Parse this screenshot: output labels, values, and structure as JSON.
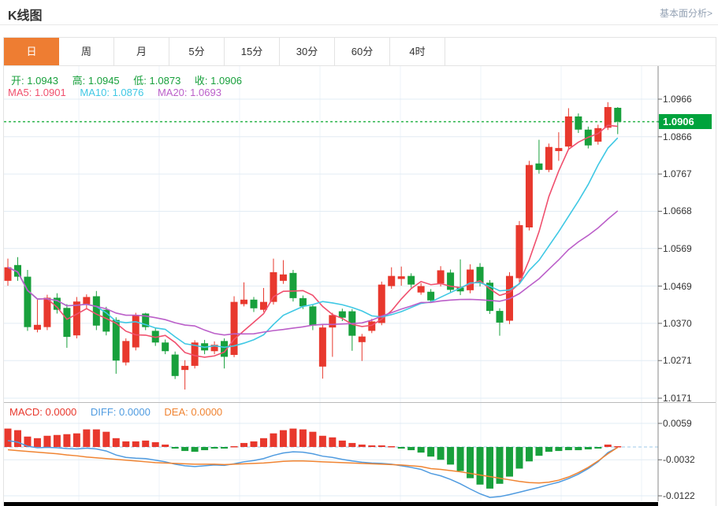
{
  "header": {
    "title": "K线图",
    "analysis_link": "基本面分析>"
  },
  "tabs": [
    {
      "label": "日",
      "active": true
    },
    {
      "label": "周",
      "active": false
    },
    {
      "label": "月",
      "active": false
    },
    {
      "label": "5分",
      "active": false
    },
    {
      "label": "15分",
      "active": false
    },
    {
      "label": "30分",
      "active": false
    },
    {
      "label": "60分",
      "active": false
    },
    {
      "label": "4时",
      "active": false
    }
  ],
  "legend": {
    "ohlc": [
      {
        "label": "开:",
        "value": "1.0943"
      },
      {
        "label": "高:",
        "value": "1.0945"
      },
      {
        "label": "低:",
        "value": "1.0873"
      },
      {
        "label": "收:",
        "value": "1.0906"
      }
    ],
    "ma": [
      {
        "label": "MA5:",
        "value": "1.0901"
      },
      {
        "label": "MA10:",
        "value": "1.0876"
      },
      {
        "label": "MA20:",
        "value": "1.0693"
      }
    ],
    "macd": [
      {
        "label": "MACD:",
        "value": "0.0000"
      },
      {
        "label": "DIFF:",
        "value": "0.0000"
      },
      {
        "label": "DEA:",
        "value": "0.0000"
      }
    ]
  },
  "y_axis": {
    "main_tick_labels": [
      "1.0966",
      "1.0866",
      "1.0767",
      "1.0668",
      "1.0569",
      "1.0469",
      "1.0370",
      "1.0271",
      "1.0171"
    ],
    "price_tag": "1.0906",
    "macd_tick_labels": [
      "0.0059",
      "-0.0032",
      "-0.0122"
    ]
  },
  "chart_data": {
    "type": "candlestick",
    "title": "K线图 (日)",
    "legend_position": "top-left",
    "grid": true,
    "colors": {
      "up": "#e8382d",
      "down": "#18a03c",
      "ma5": "#f0506e",
      "ma10": "#3fc8e4",
      "ma20": "#bb5fc9",
      "diff_line": "#4f9be0",
      "dea_line": "#f08432",
      "ohlc_text": "#18a03c",
      "grid_line": "#e2ecf4",
      "price_dotted_line": "#2ab34a",
      "price_tag_bg": "#00a33c",
      "zero_dashed_line": "#9ecae8",
      "active_tab": "#ee7d32"
    },
    "main_axis": {
      "min": 1.0171,
      "max": 1.0966,
      "ticks": [
        1.0966,
        1.0866,
        1.0767,
        1.0668,
        1.0569,
        1.0469,
        1.037,
        1.0271,
        1.0171
      ]
    },
    "price_line_value": 1.0906,
    "last": {
      "open": 1.0943,
      "high": 1.0945,
      "low": 1.0873,
      "close": 1.0906
    },
    "ma_values": {
      "ma5": 1.0901,
      "ma10": 1.0876,
      "ma20": 1.0693
    },
    "ma_periods": [
      5,
      10,
      20
    ],
    "candles": [
      [
        1.0483,
        1.0542,
        1.047,
        1.0519
      ],
      [
        1.0525,
        1.0546,
        1.0483,
        1.0494
      ],
      [
        1.0494,
        1.0512,
        1.035,
        1.036
      ],
      [
        1.0353,
        1.0433,
        1.0346,
        1.0366
      ],
      [
        1.036,
        1.0446,
        1.0352,
        1.0438
      ],
      [
        1.0438,
        1.045,
        1.0396,
        1.0406
      ],
      [
        1.0411,
        1.0421,
        1.0305,
        1.0334
      ],
      [
        1.0338,
        1.044,
        1.033,
        1.0428
      ],
      [
        1.0421,
        1.0447,
        1.041,
        1.044
      ],
      [
        1.0442,
        1.0456,
        1.0352,
        1.0364
      ],
      [
        1.0406,
        1.0414,
        1.0338,
        1.0348
      ],
      [
        1.0379,
        1.0386,
        1.0236,
        1.0271
      ],
      [
        1.0266,
        1.033,
        1.0258,
        1.0323
      ],
      [
        1.0306,
        1.0398,
        1.0298,
        1.0391
      ],
      [
        1.0396,
        1.0398,
        1.0352,
        1.036
      ],
      [
        1.035,
        1.0358,
        1.031,
        1.0319
      ],
      [
        1.0319,
        1.0327,
        1.0288,
        1.0296
      ],
      [
        1.0287,
        1.0295,
        1.0222,
        1.023
      ],
      [
        1.0246,
        1.0272,
        1.0194,
        1.0257
      ],
      [
        1.0257,
        1.0325,
        1.025,
        1.0319
      ],
      [
        1.0317,
        1.0326,
        1.0288,
        1.0298
      ],
      [
        1.0296,
        1.0322,
        1.0288,
        1.0313
      ],
      [
        1.0323,
        1.033,
        1.025,
        1.0281
      ],
      [
        1.0286,
        1.0442,
        1.028,
        1.0427
      ],
      [
        1.0421,
        1.0479,
        1.0415,
        1.0433
      ],
      [
        1.0433,
        1.044,
        1.04,
        1.041
      ],
      [
        1.0406,
        1.0464,
        1.04,
        1.0427
      ],
      [
        1.0427,
        1.0542,
        1.042,
        1.0506
      ],
      [
        1.0483,
        1.0538,
        1.0475,
        1.05
      ],
      [
        1.0504,
        1.0512,
        1.0428,
        1.0437
      ],
      [
        1.0437,
        1.0444,
        1.0408,
        1.0415
      ],
      [
        1.0415,
        1.0421,
        1.0352,
        1.0364
      ],
      [
        1.0255,
        1.0366,
        1.0223,
        1.0359
      ],
      [
        1.0359,
        1.0398,
        1.0281,
        1.0392
      ],
      [
        1.0402,
        1.0409,
        1.0376,
        1.0385
      ],
      [
        1.0402,
        1.0408,
        1.0297,
        1.0337
      ],
      [
        1.032,
        1.0342,
        1.027,
        1.0335
      ],
      [
        1.035,
        1.0382,
        1.0344,
        1.0375
      ],
      [
        1.0371,
        1.0481,
        1.0365,
        1.0473
      ],
      [
        1.0469,
        1.0519,
        1.0462,
        1.0496
      ],
      [
        1.0488,
        1.0521,
        1.047,
        1.0495
      ],
      [
        1.0496,
        1.0503,
        1.0465,
        1.0473
      ],
      [
        1.0452,
        1.0477,
        1.0446,
        1.0469
      ],
      [
        1.0454,
        1.0461,
        1.0424,
        1.0431
      ],
      [
        1.0476,
        1.0522,
        1.0468,
        1.0511
      ],
      [
        1.0505,
        1.0513,
        1.0452,
        1.0459
      ],
      [
        1.0465,
        1.054,
        1.0445,
        1.0455
      ],
      [
        1.0458,
        1.0527,
        1.045,
        1.0513
      ],
      [
        1.052,
        1.053,
        1.0468,
        1.0478
      ],
      [
        1.0478,
        1.0485,
        1.0395,
        1.0403
      ],
      [
        1.0403,
        1.041,
        1.0337,
        1.0372
      ],
      [
        1.0377,
        1.0506,
        1.0368,
        1.0496
      ],
      [
        1.049,
        1.0642,
        1.048,
        1.0631
      ],
      [
        1.0625,
        1.0802,
        1.0617,
        1.0791
      ],
      [
        1.0795,
        1.0858,
        1.0768,
        1.0778
      ],
      [
        1.0778,
        1.0848,
        1.0772,
        1.0839
      ],
      [
        1.0828,
        1.0878,
        1.0802,
        1.0836
      ],
      [
        1.084,
        1.0942,
        1.0833,
        1.092
      ],
      [
        1.092,
        1.0928,
        1.0876,
        1.0885
      ],
      [
        1.0885,
        1.0893,
        1.0835,
        1.0843
      ],
      [
        1.0853,
        1.0898,
        1.0845,
        1.0889
      ],
      [
        1.089,
        1.0958,
        1.0884,
        1.0945
      ],
      [
        1.0943,
        1.0945,
        1.0873,
        1.0906
      ]
    ],
    "macd": {
      "ticks": [
        0.0059,
        -0.0032,
        -0.0122
      ],
      "diff": [
        0.0016,
        0.0012,
        0.0002,
        -0.0002,
        -0.0001,
        -0.0002,
        -0.0004,
        -0.0005,
        -0.0003,
        -0.0005,
        -0.001,
        -0.002,
        -0.0026,
        -0.0028,
        -0.0029,
        -0.0033,
        -0.0037,
        -0.0043,
        -0.0047,
        -0.0049,
        -0.0047,
        -0.0045,
        -0.0046,
        -0.0042,
        -0.0037,
        -0.0034,
        -0.0029,
        -0.0021,
        -0.0015,
        -0.0012,
        -0.0013,
        -0.0017,
        -0.0023,
        -0.0026,
        -0.0031,
        -0.0035,
        -0.0038,
        -0.004,
        -0.0041,
        -0.0043,
        -0.0047,
        -0.0051,
        -0.0056,
        -0.0066,
        -0.0072,
        -0.0081,
        -0.0092,
        -0.0105,
        -0.0117,
        -0.0126,
        -0.0124,
        -0.0119,
        -0.0113,
        -0.0107,
        -0.0101,
        -0.0094,
        -0.0088,
        -0.0079,
        -0.0068,
        -0.0054,
        -0.0037,
        -0.0014,
        -0.0001
      ],
      "dea": [
        -0.0007,
        -0.0009,
        -0.0011,
        -0.0013,
        -0.0015,
        -0.0017,
        -0.002,
        -0.0022,
        -0.0025,
        -0.0027,
        -0.0029,
        -0.0031,
        -0.0033,
        -0.0035,
        -0.0037,
        -0.0039,
        -0.004,
        -0.0041,
        -0.0042,
        -0.0043,
        -0.0043,
        -0.0043,
        -0.0044,
        -0.0043,
        -0.0042,
        -0.0041,
        -0.004,
        -0.0038,
        -0.0036,
        -0.0035,
        -0.0035,
        -0.0036,
        -0.0037,
        -0.0038,
        -0.0039,
        -0.004,
        -0.0041,
        -0.0042,
        -0.0043,
        -0.0044,
        -0.0045,
        -0.0047,
        -0.0049,
        -0.0054,
        -0.0056,
        -0.0059,
        -0.0062,
        -0.0066,
        -0.007,
        -0.0074,
        -0.0078,
        -0.0082,
        -0.0086,
        -0.0089,
        -0.009,
        -0.0088,
        -0.0083,
        -0.0075,
        -0.0064,
        -0.0051,
        -0.0035,
        -0.0017,
        -0.0001
      ]
    }
  }
}
